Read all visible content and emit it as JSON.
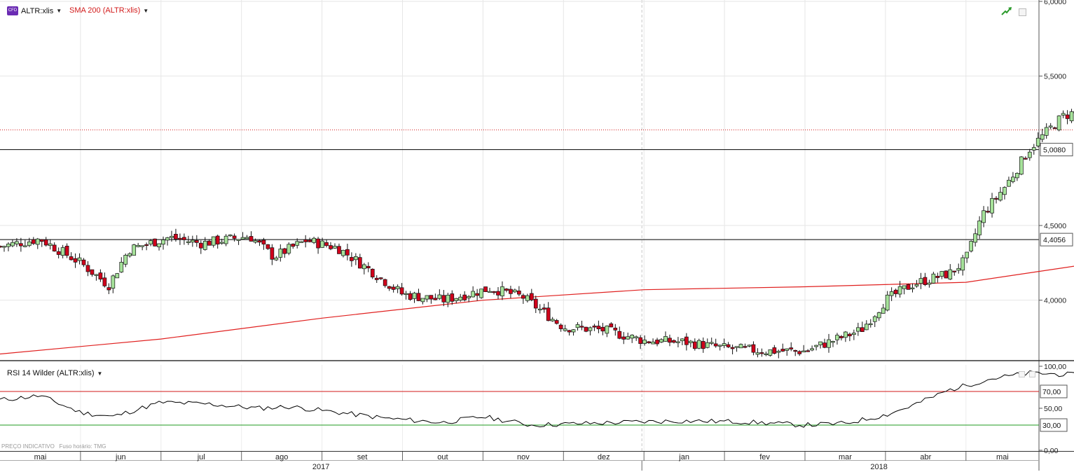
{
  "header": {
    "instrument_badge": "CFD",
    "instrument": "ALTR:xlis",
    "indicator": "SMA 200 (ALTR:xlis)",
    "caret": "▼"
  },
  "rsi_panel": {
    "label": "RSI 14 Wilder (ALTR:xlis)",
    "caret": "▼"
  },
  "footer_note": "PREÇO INDICATIVO   Fuso horário: TMG",
  "icons": {
    "trend": "trend-arrow-icon",
    "window": "window-icon"
  },
  "colors": {
    "up": "#a6e29a",
    "down": "#d0021b",
    "sma": "#e0201f",
    "rsi_line": "#000000",
    "rsi_upper": "#d21a1a",
    "rsi_lower": "#1f9a1f",
    "dotted": "#d42020"
  },
  "chart_data": [
    {
      "type": "candlestick",
      "title": "",
      "y_ticks": [
        "6,0000",
        "5,5000",
        "4,5000",
        "4,0000"
      ],
      "ylim": [
        3.6,
        6.0
      ],
      "x_months": [
        "mai",
        "jun",
        "jul",
        "ago",
        "set",
        "out",
        "nov",
        "dez",
        "jan",
        "fev",
        "mar",
        "abr",
        "mai"
      ],
      "x_years": [
        "2017",
        "2018"
      ],
      "marked_levels": [
        {
          "value": 5.008,
          "label": "5,0080"
        },
        {
          "value": 4.4056,
          "label": "4,4056"
        }
      ],
      "dotted_level": 5.14,
      "grid": true,
      "series": [
        {
          "name": "ALTR:xlis",
          "anchors": [
            [
              0,
              4.36
            ],
            [
              0.5,
              4.41
            ],
            [
              1,
              4.25
            ],
            [
              1.35,
              4.1
            ],
            [
              1.6,
              4.34
            ],
            [
              2.1,
              4.42
            ],
            [
              2.5,
              4.38
            ],
            [
              3.1,
              4.43
            ],
            [
              3.4,
              4.29
            ],
            [
              3.8,
              4.4
            ],
            [
              4.2,
              4.35
            ],
            [
              4.6,
              4.2
            ],
            [
              5.0,
              4.04
            ],
            [
              5.5,
              4.0
            ],
            [
              6.1,
              4.08
            ],
            [
              6.5,
              4.02
            ],
            [
              7.0,
              3.82
            ],
            [
              7.5,
              3.8
            ],
            [
              8.0,
              3.73
            ],
            [
              8.5,
              3.72
            ],
            [
              9.0,
              3.68
            ],
            [
              9.5,
              3.66
            ],
            [
              10.0,
              3.66
            ],
            [
              10.35,
              3.73
            ],
            [
              10.7,
              3.8
            ],
            [
              11.0,
              4.0
            ],
            [
              11.35,
              4.11
            ],
            [
              11.8,
              4.18
            ],
            [
              12.0,
              4.27
            ],
            [
              12.2,
              4.57
            ],
            [
              12.5,
              4.77
            ],
            [
              12.8,
              5.02
            ],
            [
              13.2,
              5.23
            ],
            [
              13.7,
              5.32
            ],
            [
              14.3,
              5.41
            ],
            [
              14.8,
              5.48
            ],
            [
              15.2,
              5.57
            ],
            [
              15.35,
              5.35
            ],
            [
              15.5,
              5.25
            ],
            [
              16.0,
              5.2
            ],
            [
              16.5,
              5.24
            ],
            [
              16.9,
              5.06
            ],
            [
              17.4,
              5.22
            ],
            [
              17.8,
              5.47
            ],
            [
              18.3,
              5.53
            ],
            [
              18.8,
              5.47
            ],
            [
              19.3,
              5.35
            ],
            [
              19.7,
              5.2
            ],
            [
              20.0,
              5.32
            ],
            [
              20.4,
              5.27
            ],
            [
              20.8,
              5.22
            ],
            [
              21.2,
              5.1
            ],
            [
              21.8,
              5.18
            ],
            [
              22.0,
              5.05
            ],
            [
              22.4,
              4.89
            ],
            [
              22.8,
              4.66
            ],
            [
              23.1,
              4.6
            ],
            [
              23.5,
              4.5
            ],
            [
              24.0,
              4.47
            ],
            [
              24.5,
              4.65
            ],
            [
              24.8,
              4.75
            ],
            [
              25.15,
              4.55
            ],
            [
              25.4,
              4.5
            ],
            [
              25.8,
              4.68
            ],
            [
              26.2,
              4.79
            ],
            [
              26.55,
              4.96
            ],
            [
              26.85,
              5.14
            ]
          ],
          "sma200": [
            [
              0,
              3.64
            ],
            [
              2.0,
              3.74
            ],
            [
              4.0,
              3.88
            ],
            [
              6.0,
              4.0
            ],
            [
              8.0,
              4.07
            ],
            [
              10.0,
              4.09
            ],
            [
              12.0,
              4.12
            ],
            [
              13.0,
              4.2
            ],
            [
              14.0,
              4.28
            ],
            [
              15.0,
              4.32
            ],
            [
              16.0,
              4.36
            ],
            [
              17.0,
              4.4
            ],
            [
              18.0,
              4.44
            ],
            [
              19.0,
              4.48
            ],
            [
              20.0,
              4.52
            ],
            [
              21.0,
              4.56
            ],
            [
              22.0,
              4.59
            ],
            [
              23.0,
              4.61
            ],
            [
              24.0,
              4.62
            ],
            [
              25.0,
              4.63
            ],
            [
              26.0,
              4.65
            ],
            [
              26.85,
              4.66
            ]
          ]
        }
      ]
    },
    {
      "type": "line",
      "title": "",
      "y_ticks": [
        "100,00",
        "50,00",
        "0,00"
      ],
      "ylim": [
        0,
        100
      ],
      "marked_levels": [
        {
          "value": 70,
          "label": "70,00"
        },
        {
          "value": 30,
          "label": "30,00"
        }
      ],
      "series": [
        {
          "name": "RSI 14 Wilder (ALTR:xlis)",
          "anchors": [
            [
              0,
              60
            ],
            [
              0.5,
              65
            ],
            [
              1,
              45
            ],
            [
              1.4,
              40
            ],
            [
              2.0,
              57
            ],
            [
              2.6,
              55
            ],
            [
              3.2,
              50
            ],
            [
              3.6,
              52
            ],
            [
              4.2,
              45
            ],
            [
              4.8,
              38
            ],
            [
              5.5,
              33
            ],
            [
              6.0,
              40
            ],
            [
              6.6,
              30
            ],
            [
              7.3,
              32
            ],
            [
              8.0,
              34
            ],
            [
              8.5,
              35
            ],
            [
              9.2,
              34
            ],
            [
              10.0,
              30
            ],
            [
              10.5,
              32
            ],
            [
              11.0,
              42
            ],
            [
              11.3,
              52
            ],
            [
              11.8,
              72
            ],
            [
              12.3,
              85
            ],
            [
              12.8,
              92
            ],
            [
              13.3,
              90
            ],
            [
              13.7,
              86
            ],
            [
              14.2,
              80
            ],
            [
              14.8,
              75
            ],
            [
              15.2,
              73
            ],
            [
              15.4,
              50
            ],
            [
              16.0,
              52
            ],
            [
              16.5,
              45
            ],
            [
              17.0,
              48
            ],
            [
              17.5,
              60
            ],
            [
              18.0,
              65
            ],
            [
              18.5,
              60
            ],
            [
              19.0,
              56
            ],
            [
              19.6,
              40
            ],
            [
              20.0,
              50
            ],
            [
              20.4,
              48
            ],
            [
              21.0,
              40
            ],
            [
              21.5,
              35
            ],
            [
              22.0,
              28
            ],
            [
              22.5,
              23
            ],
            [
              23.0,
              30
            ],
            [
              23.5,
              35
            ],
            [
              24.0,
              45
            ],
            [
              24.5,
              52
            ],
            [
              25.0,
              45
            ],
            [
              25.5,
              55
            ],
            [
              26.0,
              60
            ],
            [
              26.85,
              72
            ]
          ]
        }
      ]
    }
  ]
}
